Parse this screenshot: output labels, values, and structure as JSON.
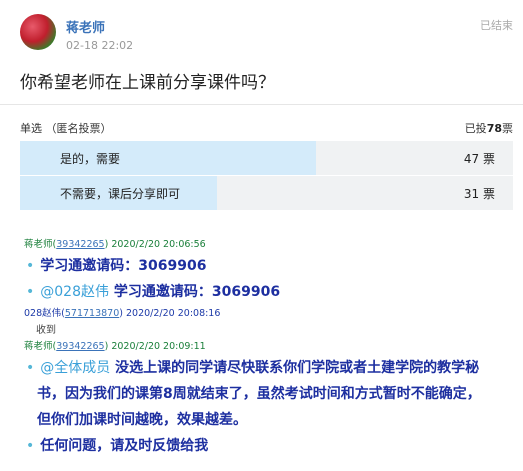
{
  "post": {
    "author": "蒋老师",
    "time": "02-18 22:02",
    "status": "已结束",
    "question": "你希望老师在上课前分享课件吗？"
  },
  "vote": {
    "type": "单选 （匿名投票）",
    "voted_prefix": "已投",
    "voted_total": "78",
    "voted_suffix": "票",
    "options": [
      {
        "label": "是的，需要",
        "votes": "47 票",
        "share": 0.6
      },
      {
        "label": "不需要，课后分享即可",
        "votes": "31 票",
        "share": 0.4
      }
    ]
  },
  "messages": [
    {
      "sender": "蒋老师",
      "uid": "39342265",
      "time": "2020/2/20 20:06:56",
      "lines": [
        {
          "mention": "",
          "text": "学习通邀请码：3069906"
        },
        {
          "mention": "@028赵伟",
          "text": "学习通邀请码：3069906"
        }
      ]
    },
    {
      "sender": "028赵伟",
      "uid": "571713870",
      "time": "2020/2/20 20:08:16",
      "text": "收到"
    },
    {
      "sender": "蒋老师",
      "uid": "39342265",
      "time": "2020/2/20 20:09:11",
      "lines": [
        {
          "mention": "@全体成员",
          "text": "没选上课的同学请尽快联系你们学院或者土建学院的教学秘"
        },
        {
          "mention": "",
          "text": "书，因为我们的课第8周就结束了，虽然考试时间和方式暂时不能确定，"
        },
        {
          "mention": "",
          "text": "但你们加课时间越晚，效果越差。"
        },
        {
          "mention": "",
          "text": "任何问题，请及时反馈给我"
        }
      ]
    }
  ],
  "colors": {
    "accent": "#3b73b9",
    "bar_fill": "#d4ebfa",
    "bar_track": "#f0f2f3",
    "message_text": "#1d2fa0",
    "meta_green": "#1a7f3a"
  },
  "icons": {
    "avatar": "red-flower-avatar"
  }
}
